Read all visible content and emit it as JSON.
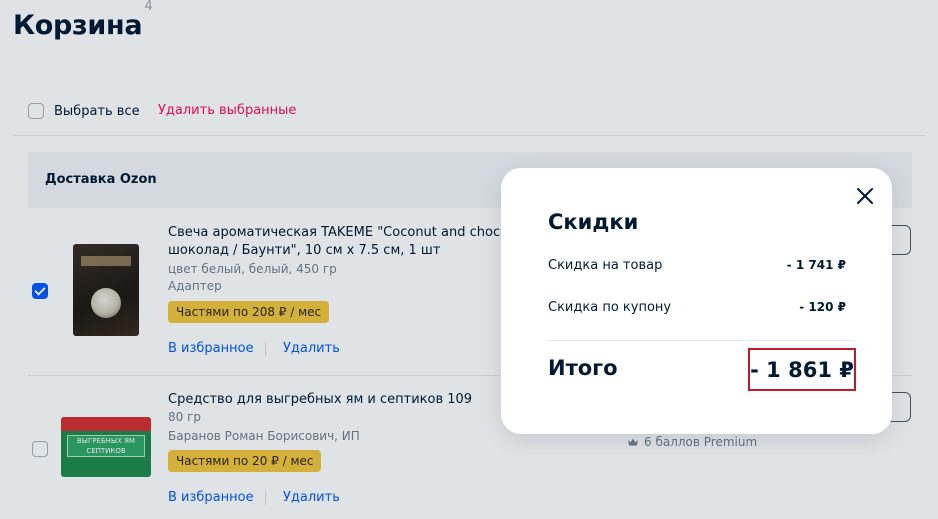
{
  "page": {
    "title": "Корзина",
    "count": "4"
  },
  "toolbar": {
    "select_all_label": "Выбрать все",
    "delete_selected_label": "Удалить выбранные"
  },
  "delivery": {
    "title": "Доставка Ozon"
  },
  "items": [
    {
      "title_line1": "Свеча ароматическая TAKEME \"Coconut and chocolat",
      "title_line2": "шоколад / Баунти\", 10 см х 7.5 см, 1 шт",
      "meta1": "цвет белый, белый, 450 гр",
      "meta2": "Адаптер",
      "installment": "Частями по 208 ₽ / мес",
      "favorite_label": "В избранное",
      "delete_label": "Удалить",
      "checked": true
    },
    {
      "title_line1": "Средство для выгребных ям и септиков 109",
      "meta1": "80 гр",
      "meta2": "Баранов Роман Борисович, ИП",
      "installment": "Частями по 20 ₽ / мес",
      "favorite_label": "В избранное",
      "delete_label": "Удалить",
      "points": "6 баллов Premium",
      "checked": false,
      "image_text_1": "ВЫГРЕБНЫХ ЯМ",
      "image_text_2": "СЕПТИКОВ"
    }
  ],
  "modal": {
    "title": "Скидки",
    "rows": [
      {
        "label": "Скидка на товар",
        "value": "- 1 741 ₽"
      },
      {
        "label": "Скидка по купону",
        "value": "- 120 ₽"
      }
    ],
    "total_label": "Итого",
    "total_value": "- 1 861 ₽",
    "highlight_color": "#c0192b"
  },
  "icons": {
    "close": "close-icon",
    "crown": "crown-icon"
  }
}
